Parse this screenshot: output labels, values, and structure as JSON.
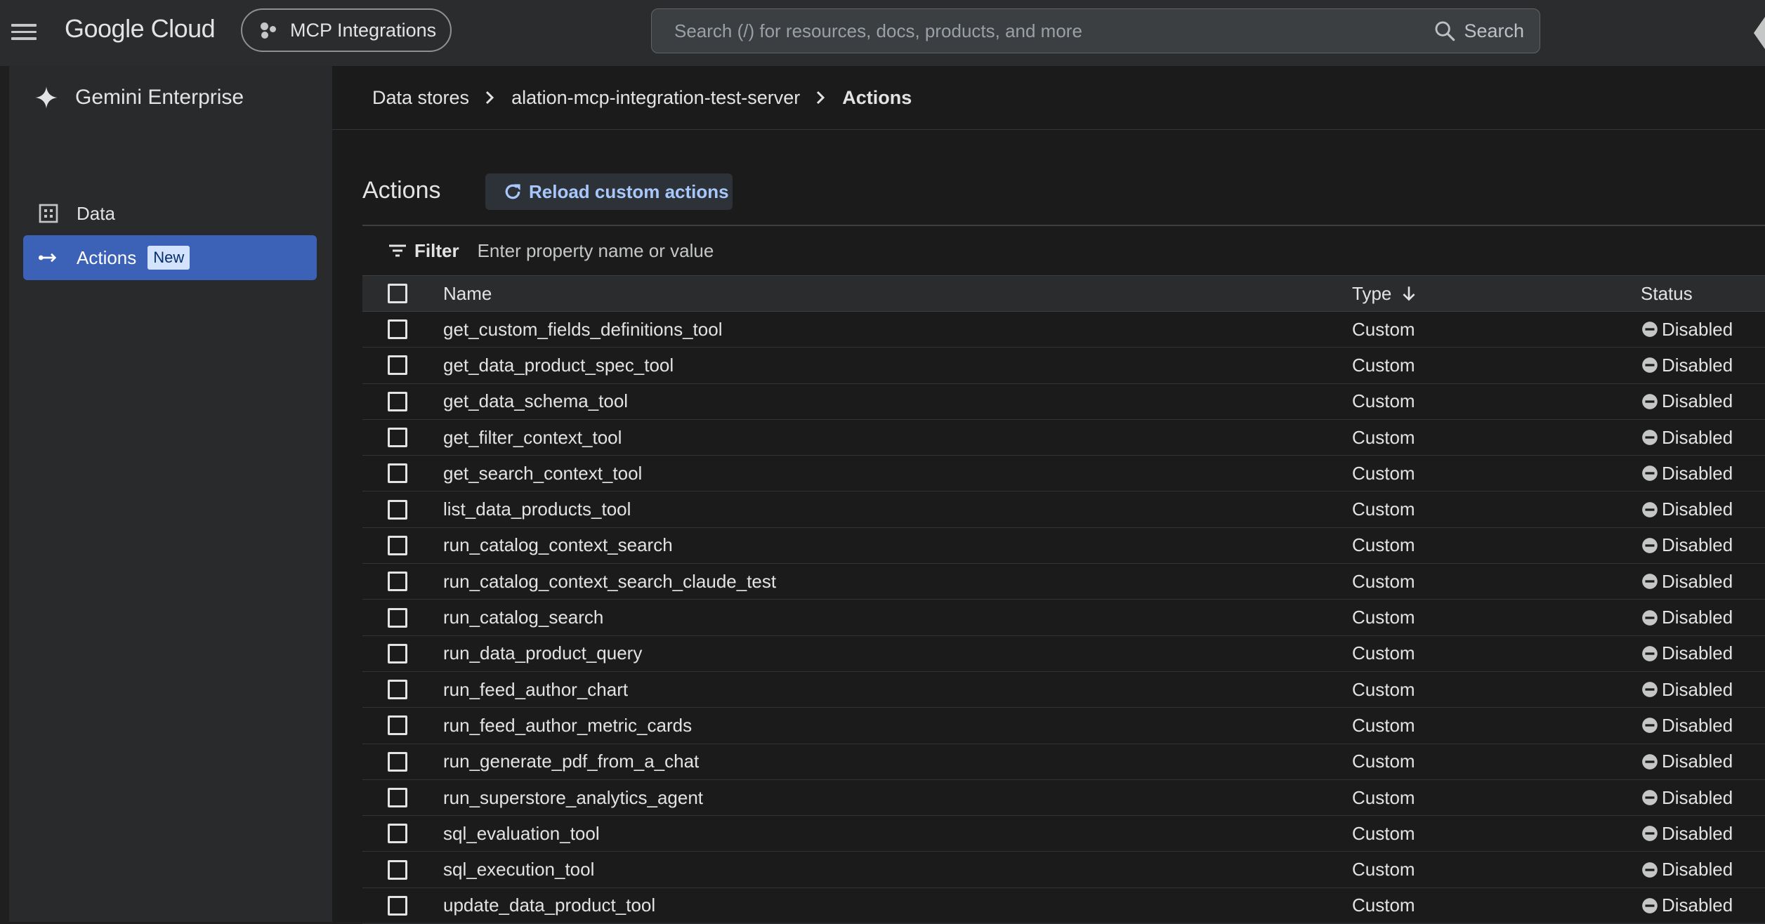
{
  "topbar": {
    "brand": "Google Cloud",
    "project": "MCP Integrations",
    "search_placeholder": "Search (/) for resources, docs, products, and more",
    "search_label": "Search"
  },
  "sidebar": {
    "title": "Gemini Enterprise",
    "items": [
      {
        "label": "Data",
        "icon": "grid-icon",
        "active": false
      },
      {
        "label": "Actions",
        "icon": "actions-icon",
        "active": true,
        "badge": "New"
      }
    ]
  },
  "breadcrumb": [
    "Data stores",
    "alation-mcp-integration-test-server",
    "Actions"
  ],
  "page": {
    "title": "Actions",
    "reload_label": "Reload custom actions"
  },
  "filter": {
    "label": "Filter",
    "placeholder": "Enter property name or value"
  },
  "table": {
    "columns": {
      "name": "Name",
      "type": "Type",
      "status": "Status"
    },
    "rows": [
      {
        "name": "get_custom_fields_definitions_tool",
        "type": "Custom",
        "status": "Disabled"
      },
      {
        "name": "get_data_product_spec_tool",
        "type": "Custom",
        "status": "Disabled"
      },
      {
        "name": "get_data_schema_tool",
        "type": "Custom",
        "status": "Disabled"
      },
      {
        "name": "get_filter_context_tool",
        "type": "Custom",
        "status": "Disabled"
      },
      {
        "name": "get_search_context_tool",
        "type": "Custom",
        "status": "Disabled"
      },
      {
        "name": "list_data_products_tool",
        "type": "Custom",
        "status": "Disabled"
      },
      {
        "name": "run_catalog_context_search",
        "type": "Custom",
        "status": "Disabled"
      },
      {
        "name": "run_catalog_context_search_claude_test",
        "type": "Custom",
        "status": "Disabled"
      },
      {
        "name": "run_catalog_search",
        "type": "Custom",
        "status": "Disabled"
      },
      {
        "name": "run_data_product_query",
        "type": "Custom",
        "status": "Disabled"
      },
      {
        "name": "run_feed_author_chart",
        "type": "Custom",
        "status": "Disabled"
      },
      {
        "name": "run_feed_author_metric_cards",
        "type": "Custom",
        "status": "Disabled"
      },
      {
        "name": "run_generate_pdf_from_a_chat",
        "type": "Custom",
        "status": "Disabled"
      },
      {
        "name": "run_superstore_analytics_agent",
        "type": "Custom",
        "status": "Disabled"
      },
      {
        "name": "sql_evaluation_tool",
        "type": "Custom",
        "status": "Disabled"
      },
      {
        "name": "sql_execution_tool",
        "type": "Custom",
        "status": "Disabled"
      },
      {
        "name": "update_data_product_tool",
        "type": "Custom",
        "status": "Disabled"
      }
    ]
  },
  "colors": {
    "accent_active": "#3b62b7",
    "link": "#a8c7fa",
    "background": "#1b1b1b"
  }
}
